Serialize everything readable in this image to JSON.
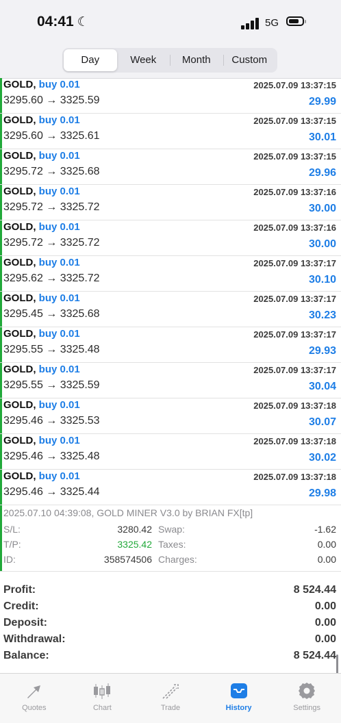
{
  "status_bar": {
    "time": "04:41",
    "network": "5G"
  },
  "period_tabs": [
    {
      "label": "Day",
      "active": true
    },
    {
      "label": "Week",
      "active": false
    },
    {
      "label": "Month",
      "active": false
    },
    {
      "label": "Custom",
      "active": false
    }
  ],
  "deals": [
    {
      "symbol": "GOLD,",
      "side": "buy 0.01",
      "time": "2025.07.09 13:37:15",
      "prices": "3295.60 → 3325.59",
      "profit": "29.99"
    },
    {
      "symbol": "GOLD,",
      "side": "buy 0.01",
      "time": "2025.07.09 13:37:15",
      "prices": "3295.60 → 3325.61",
      "profit": "30.01"
    },
    {
      "symbol": "GOLD,",
      "side": "buy 0.01",
      "time": "2025.07.09 13:37:15",
      "prices": "3295.72 → 3325.68",
      "profit": "29.96"
    },
    {
      "symbol": "GOLD,",
      "side": "buy 0.01",
      "time": "2025.07.09 13:37:16",
      "prices": "3295.72 → 3325.72",
      "profit": "30.00"
    },
    {
      "symbol": "GOLD,",
      "side": "buy 0.01",
      "time": "2025.07.09 13:37:16",
      "prices": "3295.72 → 3325.72",
      "profit": "30.00"
    },
    {
      "symbol": "GOLD,",
      "side": "buy 0.01",
      "time": "2025.07.09 13:37:17",
      "prices": "3295.62 → 3325.72",
      "profit": "30.10"
    },
    {
      "symbol": "GOLD,",
      "side": "buy 0.01",
      "time": "2025.07.09 13:37:17",
      "prices": "3295.45 → 3325.68",
      "profit": "30.23"
    },
    {
      "symbol": "GOLD,",
      "side": "buy 0.01",
      "time": "2025.07.09 13:37:17",
      "prices": "3295.55 → 3325.48",
      "profit": "29.93"
    },
    {
      "symbol": "GOLD,",
      "side": "buy 0.01",
      "time": "2025.07.09 13:37:17",
      "prices": "3295.55 → 3325.59",
      "profit": "30.04"
    },
    {
      "symbol": "GOLD,",
      "side": "buy 0.01",
      "time": "2025.07.09 13:37:18",
      "prices": "3295.46 → 3325.53",
      "profit": "30.07"
    },
    {
      "symbol": "GOLD,",
      "side": "buy 0.01",
      "time": "2025.07.09 13:37:18",
      "prices": "3295.46 → 3325.48",
      "profit": "30.02"
    },
    {
      "symbol": "GOLD,",
      "side": "buy 0.01",
      "time": "2025.07.09 13:37:18",
      "prices": "3295.46 → 3325.44",
      "profit": "29.98"
    }
  ],
  "deal_details": {
    "comment": "2025.07.10 04:39:08, GOLD MINER V3.0 by BRIAN FX[tp]",
    "sl_label": "S/L:",
    "sl_value": "3280.42",
    "tp_label": "T/P:",
    "tp_value": "3325.42",
    "id_label": "ID:",
    "id_value": "358574506",
    "swap_label": "Swap:",
    "swap_value": "-1.62",
    "taxes_label": "Taxes:",
    "taxes_value": "0.00",
    "charges_label": "Charges:",
    "charges_value": "0.00"
  },
  "summary": [
    {
      "label": "Profit:",
      "value": "8 524.44"
    },
    {
      "label": "Credit:",
      "value": "0.00"
    },
    {
      "label": "Deposit:",
      "value": "0.00"
    },
    {
      "label": "Withdrawal:",
      "value": "0.00"
    },
    {
      "label": "Balance:",
      "value": "8 524.44"
    }
  ],
  "tabbar": [
    {
      "label": "Quotes",
      "icon": "quotes-icon",
      "active": false
    },
    {
      "label": "Chart",
      "icon": "chart-icon",
      "active": false
    },
    {
      "label": "Trade",
      "icon": "trade-icon",
      "active": false
    },
    {
      "label": "History",
      "icon": "history-icon",
      "active": true
    },
    {
      "label": "Settings",
      "icon": "settings-icon",
      "active": false
    }
  ],
  "colors": {
    "accent": "#1e7ee6",
    "buy_bar": "#22a93a",
    "tp_value": "#22a93a"
  }
}
